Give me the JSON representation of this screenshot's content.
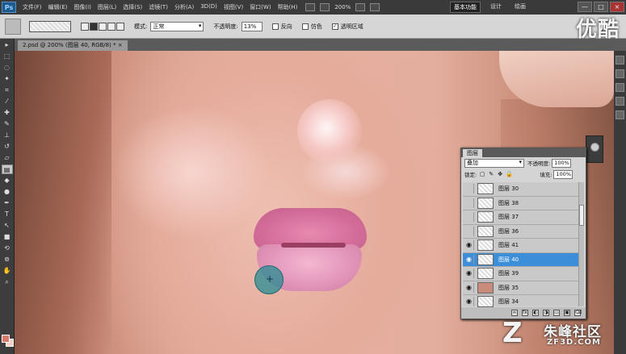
{
  "menubar": {
    "logo": "Ps",
    "items": [
      "文件(F)",
      "编辑(E)",
      "图像(I)",
      "图层(L)",
      "选择(S)",
      "滤镜(T)",
      "分析(A)",
      "3D(D)",
      "视图(V)",
      "窗口(W)",
      "帮助(H)"
    ],
    "zoom": "200%",
    "workspaces": [
      "基本功能",
      "设计",
      "绘画"
    ],
    "window_controls": [
      "—",
      "□",
      "×"
    ]
  },
  "options": {
    "mode_label": "模式:",
    "mode_value": "正常",
    "opacity_label": "不透明度:",
    "opacity_value": "13%",
    "reverse_label": "反向",
    "dither_label": "仿色",
    "transparency_label": "透明区域",
    "transparency_checked": "✓"
  },
  "document": {
    "tab_title": "2.psd @ 200% (图层 40, RGB/8) *  ×"
  },
  "layers_panel": {
    "tab_label": "图层",
    "blend_mode": "叠加",
    "opacity_label": "不透明度:",
    "opacity_value": "100%",
    "lock_label": "锁定:",
    "fill_label": "填充:",
    "fill_value": "100%",
    "layers": [
      {
        "name": "图层 30",
        "visible": false,
        "selected": false,
        "filled": false
      },
      {
        "name": "图层 38",
        "visible": false,
        "selected": false,
        "filled": false
      },
      {
        "name": "图层 37",
        "visible": false,
        "selected": false,
        "filled": false
      },
      {
        "name": "图层 36",
        "visible": false,
        "selected": false,
        "filled": false
      },
      {
        "name": "图层 41",
        "visible": true,
        "selected": false,
        "filled": false
      },
      {
        "name": "图层 40",
        "visible": true,
        "selected": true,
        "filled": false
      },
      {
        "name": "图层 39",
        "visible": true,
        "selected": false,
        "filled": false
      },
      {
        "name": "图层 35",
        "visible": true,
        "selected": false,
        "filled": true
      },
      {
        "name": "图层 34",
        "visible": true,
        "selected": false,
        "filled": false
      }
    ]
  },
  "watermarks": {
    "top_right": "优酷",
    "bottom_logo": "Z",
    "bottom_cn": "朱峰社区",
    "bottom_en": "ZF3D.COM"
  },
  "colors": {
    "foreground": "#d77a6b",
    "background": "#f2d0c6",
    "selection": "#3b8ed7"
  }
}
